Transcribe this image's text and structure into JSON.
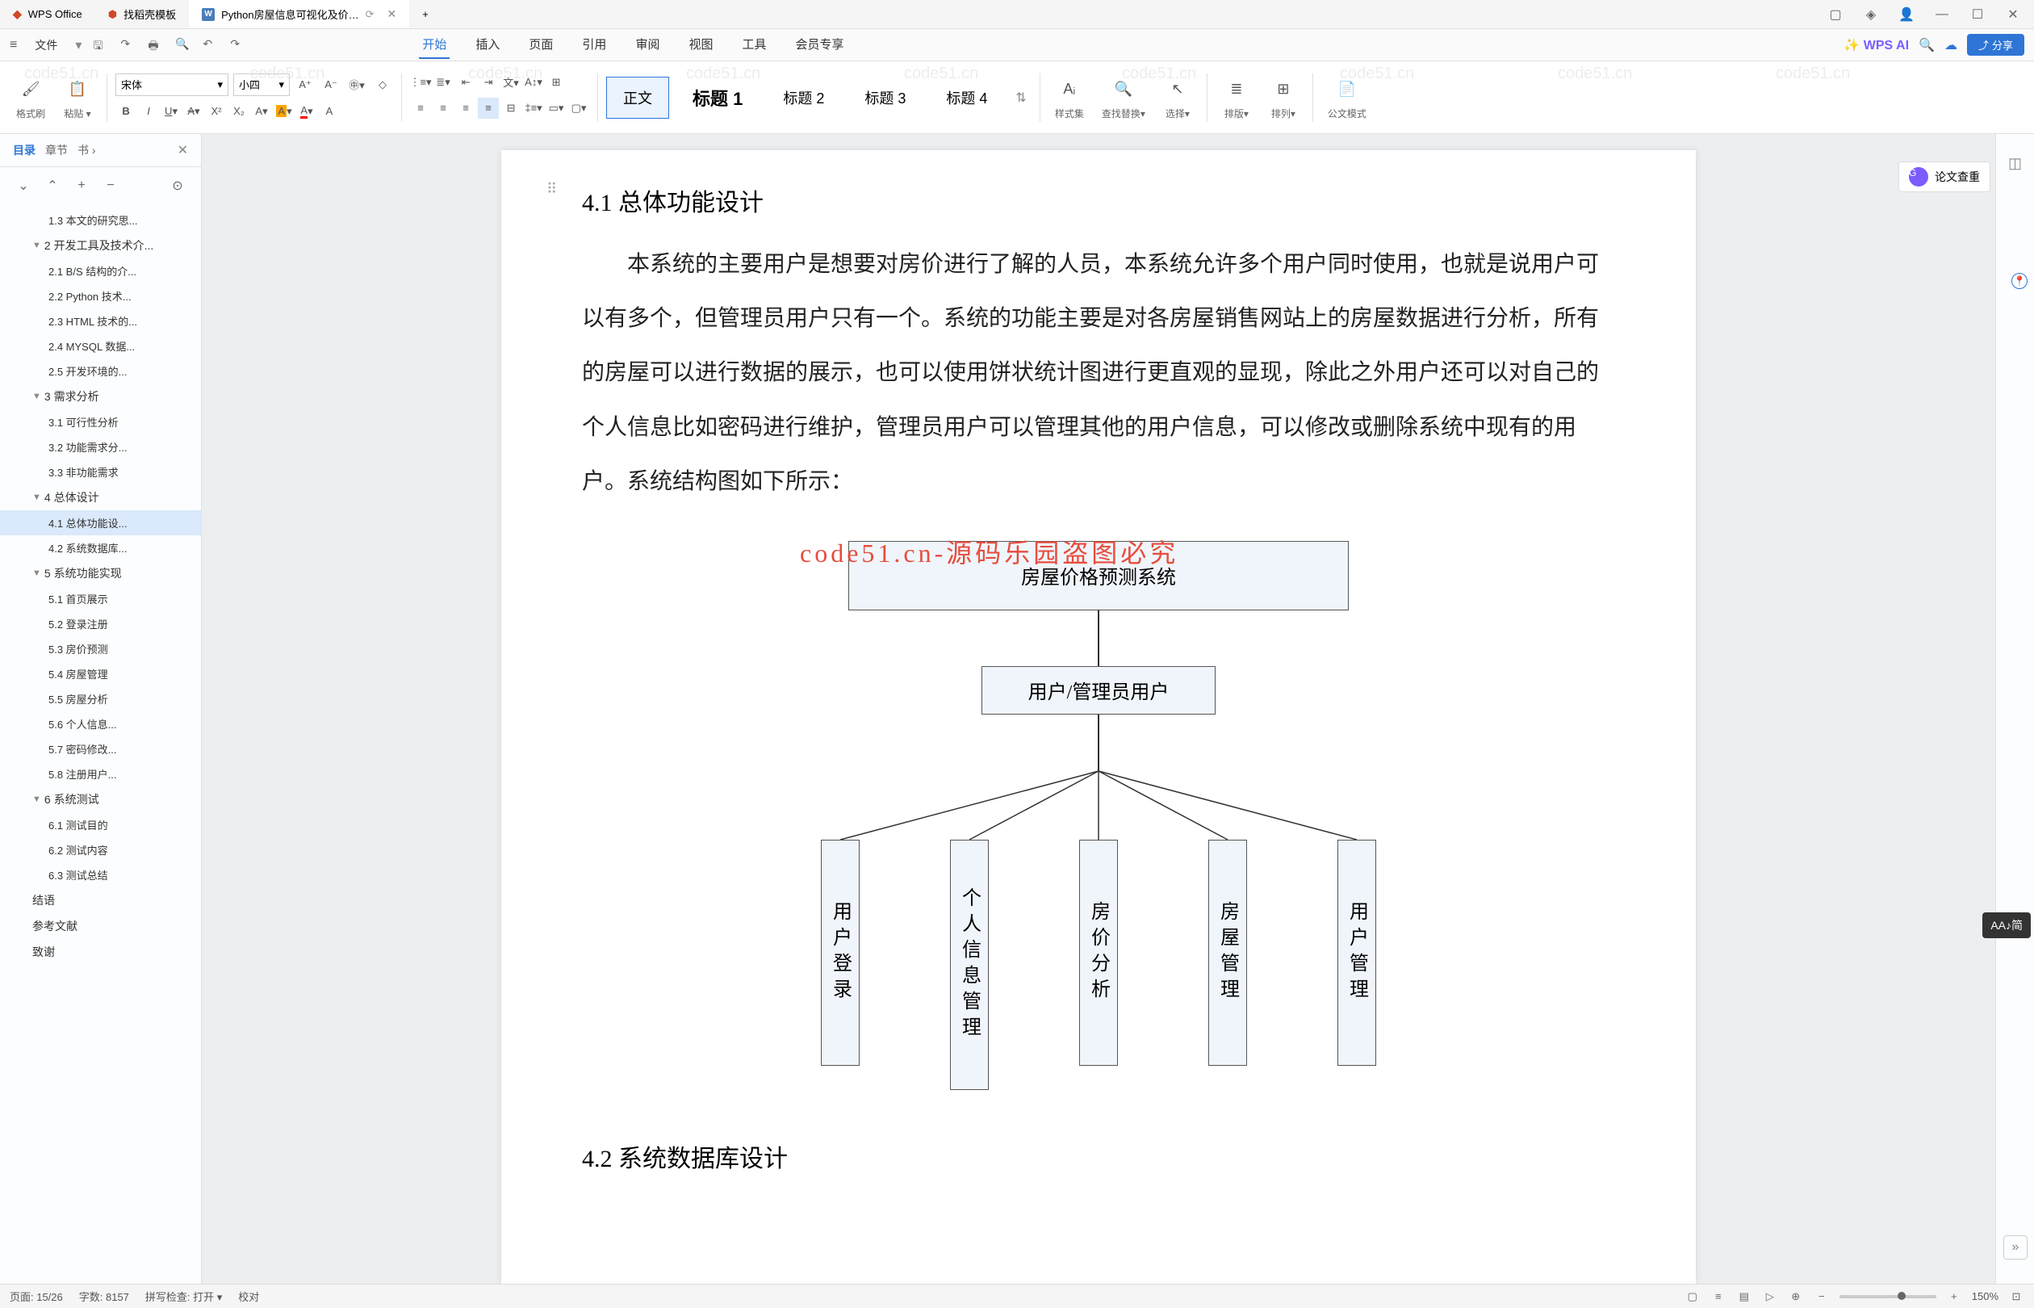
{
  "titlebar": {
    "app_name": "WPS Office",
    "tab2": "找稻壳模板",
    "tab3": "Python房屋信息可视化及价…",
    "doc_icon": "W"
  },
  "menubar": {
    "file": "文件",
    "tabs": [
      "开始",
      "插入",
      "页面",
      "引用",
      "审阅",
      "视图",
      "工具",
      "会员专享"
    ],
    "wps_ai": "WPS AI",
    "share": "分享"
  },
  "ribbon": {
    "format_painter": "格式刷",
    "paste": "粘贴",
    "font_name": "宋体",
    "font_size": "小四",
    "styles": {
      "normal": "正文",
      "h1": "标题 1",
      "h2": "标题 2",
      "h3": "标题 3",
      "h4": "标题 4"
    },
    "style_set": "样式集",
    "find_replace": "查找替换",
    "select": "选择",
    "arrange": "排版",
    "arrange2": "排列",
    "gov_mode": "公文模式"
  },
  "sidebar": {
    "tab_outline": "目录",
    "tab_sections": "章节",
    "tab_book": "书",
    "items": [
      {
        "level": 2,
        "text": "1.3 本文的研究思..."
      },
      {
        "level": 1,
        "text": "2 开发工具及技术介...",
        "expand": true
      },
      {
        "level": 2,
        "text": "2.1 B/S 结构的介..."
      },
      {
        "level": 2,
        "text": "2.2 Python 技术..."
      },
      {
        "level": 2,
        "text": "2.3 HTML 技术的..."
      },
      {
        "level": 2,
        "text": "2.4 MYSQL 数据..."
      },
      {
        "level": 2,
        "text": "2.5 开发环境的..."
      },
      {
        "level": 1,
        "text": "3 需求分析",
        "expand": true
      },
      {
        "level": 2,
        "text": "3.1 可行性分析"
      },
      {
        "level": 2,
        "text": "3.2 功能需求分..."
      },
      {
        "level": 2,
        "text": "3.3 非功能需求"
      },
      {
        "level": 1,
        "text": "4 总体设计",
        "expand": true
      },
      {
        "level": 2,
        "text": "4.1 总体功能设...",
        "active": true
      },
      {
        "level": 2,
        "text": "4.2 系统数据库..."
      },
      {
        "level": 1,
        "text": "5 系统功能实现",
        "expand": true
      },
      {
        "level": 2,
        "text": "5.1 首页展示"
      },
      {
        "level": 2,
        "text": "5.2 登录注册"
      },
      {
        "level": 2,
        "text": "5.3 房价预测"
      },
      {
        "level": 2,
        "text": "5.4 房屋管理"
      },
      {
        "level": 2,
        "text": "5.5 房屋分析"
      },
      {
        "level": 2,
        "text": "5.6 个人信息..."
      },
      {
        "level": 2,
        "text": "5.7 密码修改..."
      },
      {
        "level": 2,
        "text": "5.8 注册用户..."
      },
      {
        "level": 1,
        "text": "6 系统测试",
        "expand": true
      },
      {
        "level": 2,
        "text": "6.1 测试目的"
      },
      {
        "level": 2,
        "text": "6.2 测试内容"
      },
      {
        "level": 2,
        "text": "6.3 测试总结"
      },
      {
        "level": 1,
        "text": "结语"
      },
      {
        "level": 1,
        "text": "参考文献"
      },
      {
        "level": 1,
        "text": "致谢"
      }
    ]
  },
  "document": {
    "sec_4_1": "4.1 总体功能设计",
    "para1": "本系统的主要用户是想要对房价进行了解的人员，本系统允许多个用户同时使用，也就是说用户可以有多个，但管理员用户只有一个。系统的功能主要是对各房屋销售网站上的房屋数据进行分析，所有的房屋可以进行数据的展示，也可以使用饼状统计图进行更直观的显现，除此之外用户还可以对自己的个人信息比如密码进行维护，管理员用户可以管理其他的用户信息，可以修改或删除系统中现有的用户。系统结构图如下所示：",
    "sec_4_2": "4.2 系统数据库设计",
    "overlay": "code51.cn-源码乐园盗图必究"
  },
  "flowchart": {
    "top": "房屋价格预测系统",
    "mid": "用户/管理员用户",
    "leaves": [
      "用户登录",
      "个人信息管理",
      "房价分析",
      "房屋管理",
      "用户管理"
    ]
  },
  "right_panel": {
    "paper_check": "论文查重"
  },
  "statusbar": {
    "page": "页面: 15/26",
    "words": "字数: 8157",
    "spell": "拼写检查: 打开",
    "proof": "校对",
    "zoom": "150%"
  },
  "float": {
    "aa": "AA♪简"
  },
  "watermark": "code51.cn"
}
